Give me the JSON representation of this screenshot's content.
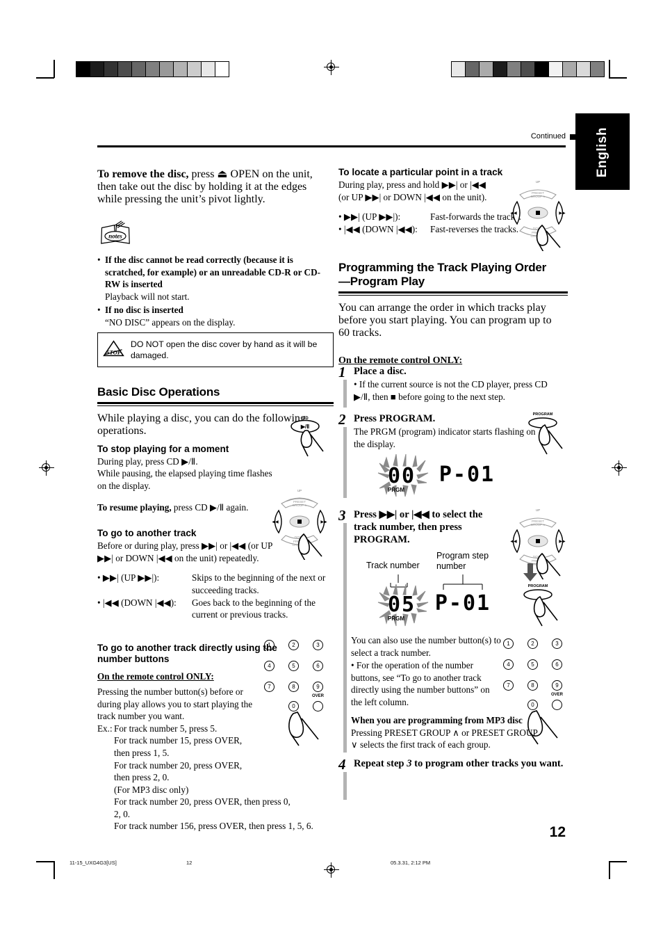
{
  "header": {
    "continued_label": "Continued",
    "language_tab": "English",
    "page_number": "12"
  },
  "footer": {
    "file_label": "11-15_UXG4G3[US]",
    "page_label": "12",
    "timestamp": "05.3.31, 2:12 PM"
  },
  "left_column": {
    "remove_disc": {
      "lead_bold": "To remove the disc,",
      "body": " press ⏏ OPEN on the unit, then take out the disc by holding it at the edges while pressing the unit’s pivot lightly."
    },
    "notes_icon_label": "notes",
    "notes": [
      {
        "title": "If the disc cannot be read correctly (because it is scratched, for example) or an unreadable CD-R or CD-RW is inserted",
        "body": "Playback will not start."
      },
      {
        "title": "If no disc is inserted",
        "body": "“NO DISC” appears on the display."
      }
    ],
    "caution": {
      "icon_label": "STOP",
      "text": "DO NOT open the disc cover by hand as it will be damaged."
    },
    "section_title": "Basic Disc Operations",
    "section_intro": "While playing a disc, you can do the following operations.",
    "stop_moment": {
      "heading": "To stop playing for a moment",
      "line1": "During play, press CD ▶/Ⅱ.",
      "line2": "While pausing, the elapsed playing time flashes on the display.",
      "resume_bold": "To resume playing,",
      "resume_rest": " press CD ▶/Ⅱ again.",
      "button_label": "CD",
      "button_glyph": "▶/Ⅱ"
    },
    "another_track": {
      "heading": "To go to another track",
      "body": "Before or during play, press ▶▶| or |◀◀  (or UP ▶▶| or DOWN |◀◀ on the unit) repeatedly.",
      "rows": [
        {
          "key": "• ▶▶| (UP ▶▶|):",
          "value": "Skips to the beginning of the next or succeeding tracks."
        },
        {
          "key": "• |◀◀ (DOWN |◀◀):",
          "value": "Goes back to the beginning of the current or previous tracks."
        }
      ]
    },
    "number_buttons": {
      "heading": "To go to another track directly using the number buttons",
      "remote_only": "On the remote control ONLY:",
      "body": "Pressing the number button(s) before or during play allows you to start playing the track number you want.",
      "ex_label": "Ex.:",
      "examples": [
        "For track number 5, press 5.",
        "For track number 15, press OVER, then press 1, 5.",
        "For track number 20, press OVER, then press 2, 0.",
        "(For MP3 disc only)",
        "For track number 20, press OVER, then press 0, 2, 0.",
        "For track number 156, press OVER, then press 1, 5, 6."
      ]
    }
  },
  "right_column": {
    "locate_point": {
      "heading": "To locate a particular point in a track",
      "body": "During play, press and hold ▶▶| or |◀◀ (or UP ▶▶| or DOWN |◀◀ on the unit).",
      "rows": [
        {
          "key": "• ▶▶| (UP ▶▶|):",
          "value": "Fast-forwards the tracks."
        },
        {
          "key": "• |◀◀ (DOWN |◀◀):",
          "value": "Fast-reverses the tracks."
        }
      ]
    },
    "program_section": {
      "title_line1": "Programming the Track Playing Order",
      "title_line2": "—Program Play",
      "intro": "You can arrange the order in which tracks play before you start playing. You can program up to 60 tracks.",
      "remote_only": "On the remote control ONLY:"
    },
    "steps": [
      {
        "num": "1",
        "heading": "Place a disc.",
        "body": "• If the current source is not the CD player, press CD ▶/Ⅱ, then ■ before going to the next step."
      },
      {
        "num": "2",
        "heading": "Press PROGRAM.",
        "body": "The PRGM (program) indicator starts flashing on the display.",
        "button_label": "PROGRAM"
      },
      {
        "num": "3",
        "heading": "Press ▶▶| or |◀◀ to select the track number, then press PROGRAM.",
        "callout_track": "Track number",
        "callout_step": "Program step number",
        "body": "You can also use the number button(s) to select a track number.",
        "bullet": "• For the operation of the number buttons, see “To go to another track directly using the number buttons” on the left column.",
        "button_label": "PROGRAM",
        "mp3_title": "When you are programming from MP3 disc",
        "mp3_body": "Pressing PRESET GROUP ∧ or PRESET GROUP ∨ selects the first track of each group."
      },
      {
        "num": "4",
        "heading_pre": "Repeat step ",
        "heading_num": "3",
        "heading_post": " to program other tracks you want."
      }
    ],
    "display_step2": {
      "track": "00",
      "prgm": "PRGM",
      "program": "P-01"
    },
    "display_step3": {
      "track": "05",
      "prgm": "PRGM",
      "program": "P-01"
    }
  },
  "nav_pad": {
    "up_label": "UP",
    "up_preset": "PRESET",
    "up_group": "GROUP ∧",
    "down_label": "DOWN",
    "down_preset": "PRESET",
    "down_group": "GROUP ∨",
    "left_glyph": "|◀◀",
    "right_glyph": "▶▶|",
    "center_glyph": "■"
  },
  "numpad": {
    "keys": [
      "1",
      "2",
      "3",
      "4",
      "5",
      "6",
      "7",
      "8",
      "9",
      "0"
    ],
    "over_label": "OVER"
  },
  "colors": {
    "ink": "#000000",
    "step_bar": "#b3b3b3",
    "grey_line": "#808080"
  },
  "grey_strip_left": [
    "#000000",
    "#1c1c1c",
    "#333333",
    "#4d4d4d",
    "#666666",
    "#808080",
    "#999999",
    "#b3b3b3",
    "#cccccc",
    "#e8e8e8",
    "#ffffff"
  ],
  "grey_strip_right": [
    "#e8e8e8",
    "#666666",
    "#aaaaaa",
    "#1c1c1c",
    "#808080",
    "#4d4d4d",
    "#000000",
    "#f2f2f2",
    "#aaaaaa",
    "#d9d9d9",
    "#808080"
  ]
}
